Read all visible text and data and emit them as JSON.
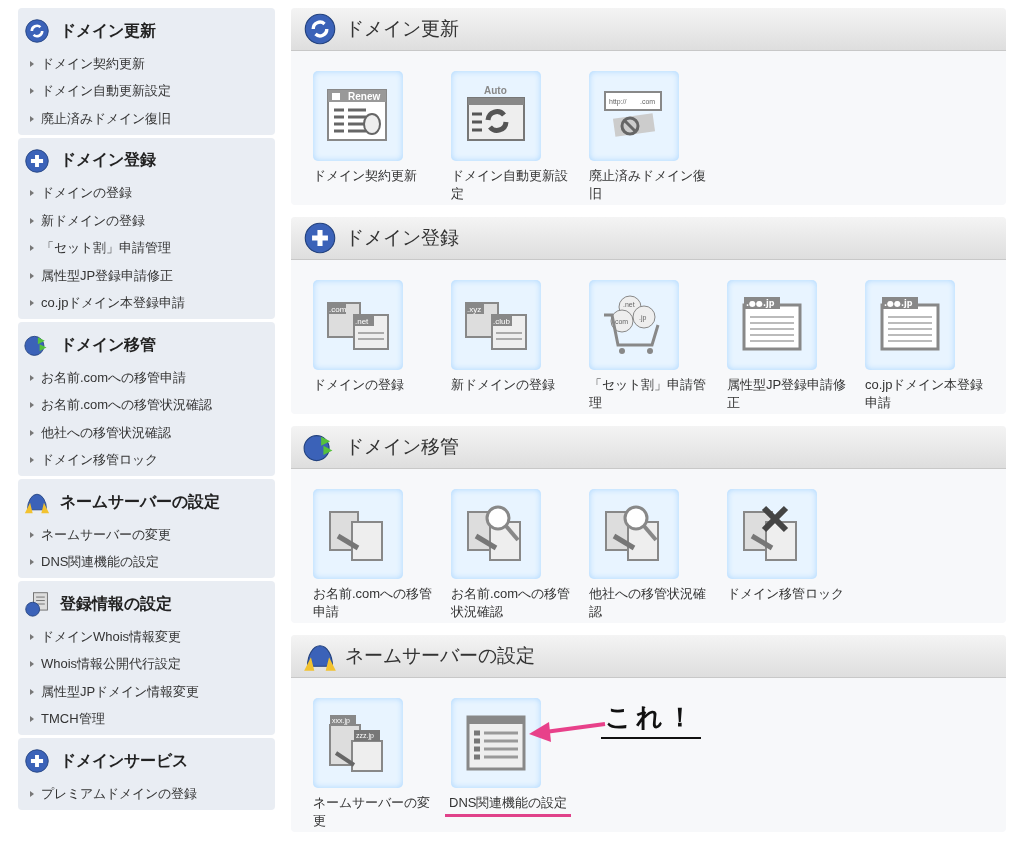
{
  "sidebar": {
    "sections": [
      {
        "title": "ドメイン更新",
        "items": [
          "ドメイン契約更新",
          "ドメイン自動更新設定",
          "廃止済みドメイン復旧"
        ]
      },
      {
        "title": "ドメイン登録",
        "items": [
          "ドメインの登録",
          "新ドメインの登録",
          "「セット割」申請管理",
          "属性型JP登録申請修正",
          "co.jpドメイン本登録申請"
        ]
      },
      {
        "title": "ドメイン移管",
        "items": [
          "お名前.comへの移管申請",
          "お名前.comへの移管状況確認",
          "他社への移管状況確認",
          "ドメイン移管ロック"
        ]
      },
      {
        "title": "ネームサーバーの設定",
        "items": [
          "ネームサーバーの変更",
          "DNS関連機能の設定"
        ]
      },
      {
        "title": "登録情報の設定",
        "items": [
          "ドメインWhois情報変更",
          "Whois情報公開代行設定",
          "属性型JPドメイン情報変更",
          "TMCH管理"
        ]
      },
      {
        "title": "ドメインサービス",
        "items": [
          "プレミアムドメインの登録"
        ]
      }
    ]
  },
  "main": {
    "sections": [
      {
        "title": "ドメイン更新",
        "tiles": [
          {
            "kind": "renew",
            "label": "ドメイン契約更新",
            "icon_texts": [
              "Renew"
            ],
            "highlighted": false
          },
          {
            "kind": "auto",
            "label": "ドメイン自動更新設定",
            "icon_texts": [
              "Auto"
            ],
            "highlighted": false
          },
          {
            "kind": "restore",
            "label": "廃止済みドメイン復旧",
            "icon_texts": [
              "http://",
              ".com"
            ],
            "highlighted": false
          }
        ]
      },
      {
        "title": "ドメイン登録",
        "tiles": [
          {
            "kind": "domains",
            "label": "ドメインの登録",
            "icon_texts": [
              ".com",
              ".net"
            ],
            "highlighted": false
          },
          {
            "kind": "domains",
            "label": "新ドメインの登録",
            "icon_texts": [
              ".xyz",
              ".club"
            ],
            "highlighted": false
          },
          {
            "kind": "cart",
            "label": "「セット割」申請管理",
            "icon_texts": [
              ".net",
              ".com",
              ".jp"
            ],
            "highlighted": false
          },
          {
            "kind": "jp",
            "label": "属性型JP登録申請修正",
            "icon_texts": [
              ".●●.jp"
            ],
            "highlighted": false
          },
          {
            "kind": "jp",
            "label": "co.jpドメイン本登録申請",
            "icon_texts": [
              ".●●.jp"
            ],
            "highlighted": false
          }
        ]
      },
      {
        "title": "ドメイン移管",
        "tiles": [
          {
            "kind": "transfer",
            "label": "お名前.comへの移管申請",
            "highlighted": false
          },
          {
            "kind": "transfer-search",
            "label": "お名前.comへの移管状況確認",
            "highlighted": false
          },
          {
            "kind": "transfer-search",
            "label": "他社への移管状況確認",
            "highlighted": false
          },
          {
            "kind": "transfer-lock",
            "label": "ドメイン移管ロック",
            "highlighted": false
          }
        ]
      },
      {
        "title": "ネームサーバーの設定",
        "tiles": [
          {
            "kind": "nameserver",
            "label": "ネームサーバーの変更",
            "icon_texts": [
              "xxx.jp",
              "zzz.jp"
            ],
            "highlighted": false
          },
          {
            "kind": "dns",
            "label": "DNS関連機能の設定",
            "highlighted": true
          }
        ]
      }
    ]
  },
  "annotation": {
    "text": "これ！"
  }
}
